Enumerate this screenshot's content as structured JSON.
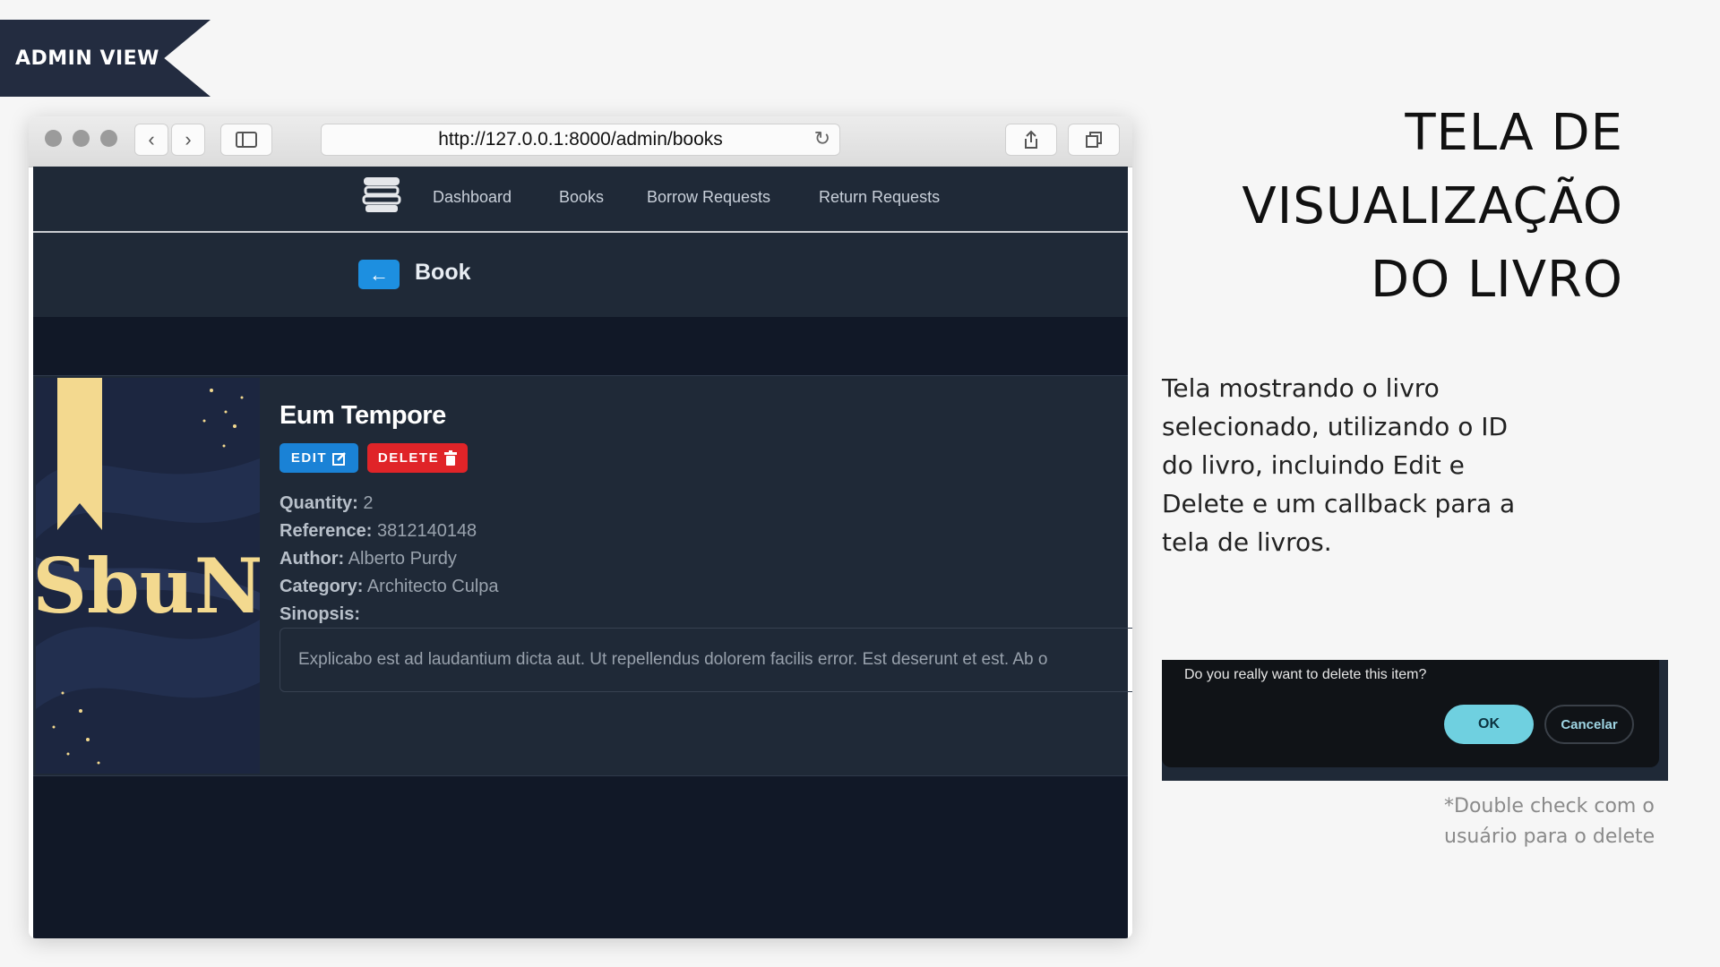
{
  "ribbon": {
    "label": "ADMIN VIEW"
  },
  "browser": {
    "url": "http://127.0.0.1:8000/admin/books",
    "nav": [
      "Dashboard",
      "Books",
      "Borrow Requests",
      "Return Requests"
    ],
    "page_title": "Book",
    "book": {
      "title": "Eum Tempore",
      "edit_label": "EDIT",
      "delete_label": "DELETE",
      "quantity_label": "Quantity:",
      "quantity": "2",
      "reference_label": "Reference:",
      "reference": "3812140148",
      "author_label": "Author:",
      "author": "Alberto Purdy",
      "category_label": "Category:",
      "category": "Architecto Culpa",
      "synopsis_label": "Sinopsis:",
      "synopsis": "Explicabo est ad laudantium dicta aut. Ut repellendus dolorem facilis error. Est deserunt et est. Ab o",
      "cover_text": "SbuN"
    }
  },
  "heading": {
    "line1": "TELA DE",
    "line2": "VISUALIZAÇÃO",
    "line3": "DO LIVRO"
  },
  "description": "Tela mostrando o livro selecionado, utilizando o ID do livro, incluindo Edit e Delete e um callback para a tela de livros.",
  "dialog": {
    "message": "Do you really want to delete this item?",
    "ok_label": "OK",
    "cancel_label": "Cancelar"
  },
  "note": "*Double check com o usuário para o delete",
  "colors": {
    "ribbon": "#232c40",
    "app_bg": "#111827",
    "panel": "#1f2937",
    "edit": "#1a82d6",
    "delete": "#e02428",
    "ok": "#6fd0e0",
    "bookmark": "#f3d98f"
  }
}
